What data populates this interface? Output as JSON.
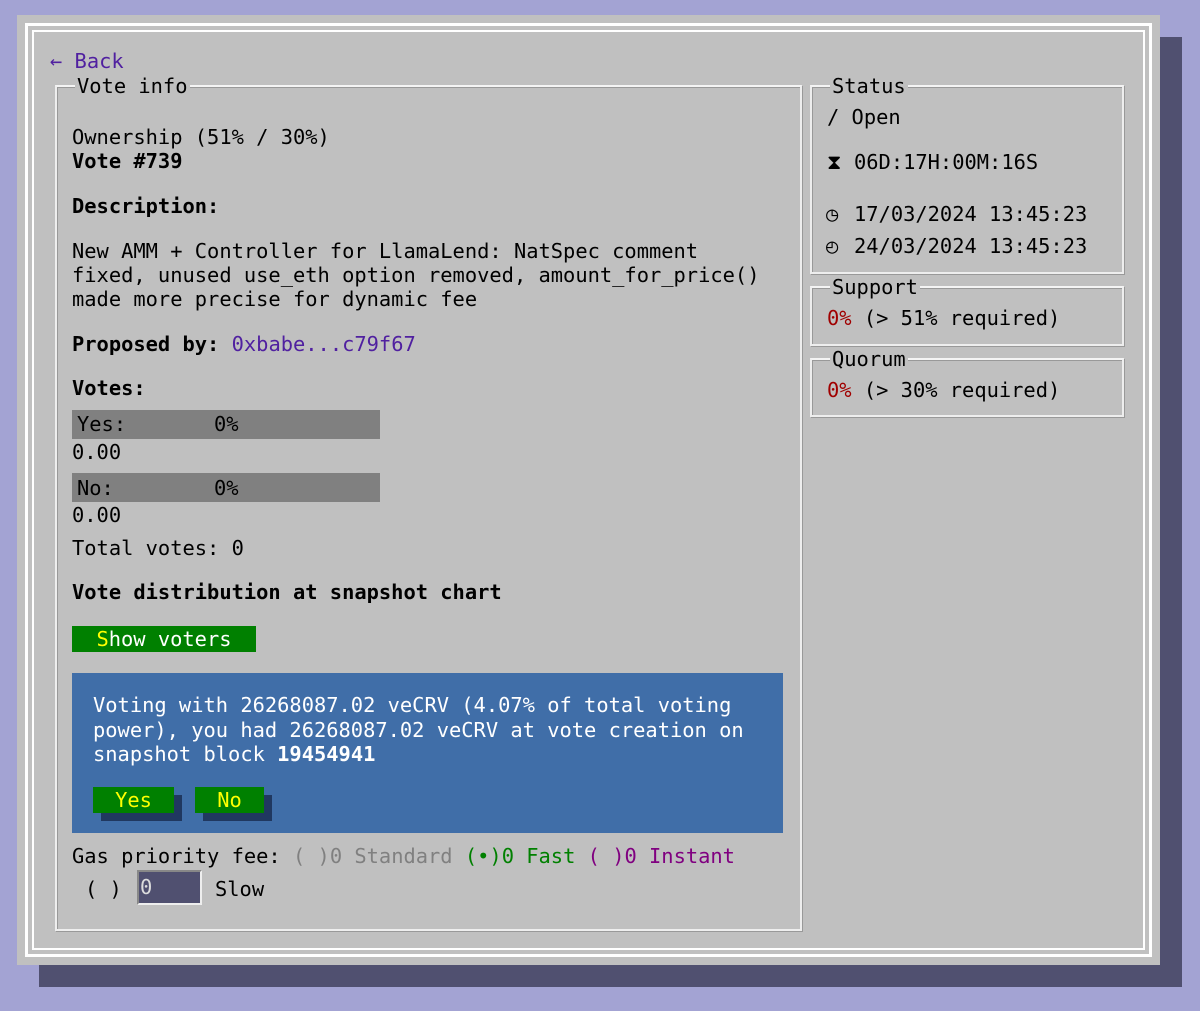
{
  "nav": {
    "back_label": "← Back"
  },
  "vote_info": {
    "legend": "Vote info",
    "ownership": "Ownership (51% / 30%)",
    "vote_number": "Vote #739",
    "description_label": "Description:",
    "description_lines": [
      "New AMM + Controller for LlamaLend: NatSpec comment",
      "fixed, unused use_eth option removed, amount_for_price()",
      "made more precise for dynamic fee"
    ],
    "proposed_by_label": "Proposed by:",
    "proposer": "0xbabe...c79f67",
    "votes_label": "Votes:",
    "yes": {
      "label": "Yes:",
      "percent": "0%",
      "amount": "0.00",
      "fill_fraction": 0
    },
    "no": {
      "label": "No:",
      "percent": "0%",
      "amount": "0.00",
      "fill_fraction": 0
    },
    "total_votes": "Total votes: 0",
    "distribution": "Vote distribution at snapshot chart",
    "show_voters": {
      "hotkey": "S",
      "rest": "how voters"
    }
  },
  "voting_panel": {
    "lines": [
      "Voting with 26268087.02 veCRV (4.07% of total voting",
      "power), you had 26268087.02 veCRV at vote creation on"
    ],
    "line3_prefix": "snapshot block ",
    "block": "19454941",
    "yes_button": "Yes",
    "no_button": "No"
  },
  "gas": {
    "label": "Gas priority fee:",
    "standard": "( )0 Standard",
    "fast": "(•)0 Fast",
    "instant": "( )0 Instant",
    "slow_radio": "( )",
    "slow_value": "0",
    "slow_label": "Slow"
  },
  "status": {
    "legend": "Status",
    "state": "/ Open",
    "countdown": "06D:17H:00M:16S",
    "start": "17/03/2024 13:45:23",
    "end": "24/03/2024 13:45:23"
  },
  "support": {
    "legend": "Support",
    "value": "0%",
    "required": " (> 51% required)"
  },
  "quorum": {
    "legend": "Quorum",
    "value": "0%",
    "required": " (> 30% required)"
  },
  "colors": {
    "background": "#a3a3d3",
    "panel": "#c0c0c0",
    "link": "#5020a0",
    "blue_box": "#406ea8",
    "button": "#008000",
    "fast": "#008000",
    "instant": "#800080",
    "standard": "#808080",
    "red": "#a00000"
  }
}
